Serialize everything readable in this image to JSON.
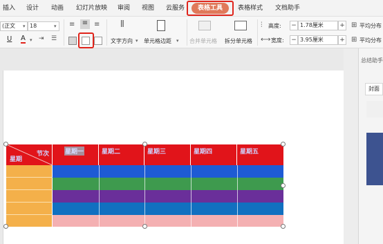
{
  "menubar": {
    "items": [
      "插入",
      "设计",
      "动画",
      "幻灯片放映",
      "审阅",
      "视图",
      "云服务",
      "表格工具",
      "表格样式",
      "文档助手"
    ],
    "active_index": 7
  },
  "ribbon": {
    "font_name": "(正文",
    "font_size": "18",
    "text_direction_label": "文字方向",
    "cell_margin_label": "单元格边距",
    "merge_cells_label": "合并单元格",
    "split_cells_label": "拆分单元格",
    "height_label": "高度:",
    "height_value": "1.78厘米",
    "width_label": "宽度:",
    "width_value": "3.95厘米",
    "distribute_rows_label": "平均分布",
    "distribute_cols_label": "平均分布",
    "minus": "−",
    "plus": "+"
  },
  "side_panel": {
    "title": "总结助手",
    "tab_cover": "封面"
  },
  "table": {
    "corner_top_right": "节次",
    "corner_bottom_left": "星期",
    "header_days": [
      "星期一",
      "星期二",
      "星期三",
      "星期四",
      "星期五"
    ],
    "header_bg": "#e1141a",
    "first_col_color": "#f4b04a",
    "row_colors": [
      "#1e5bd4",
      "#3e9a4e",
      "#6a2f9a",
      "#1170c0",
      "#f4b0b2"
    ]
  }
}
